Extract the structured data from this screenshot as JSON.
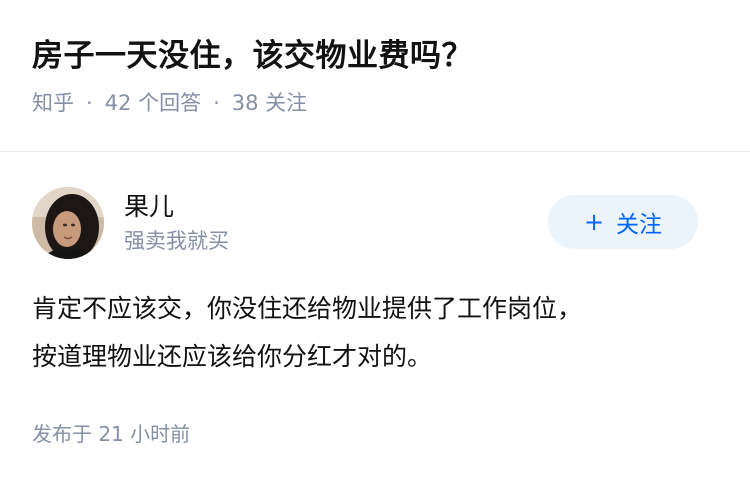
{
  "question": {
    "title": "房子一天没住，该交物业费吗？",
    "source": "知乎",
    "separator": "·",
    "answer_count": "42 个回答",
    "follower_count": "38 关注"
  },
  "answer": {
    "author_name": "果儿",
    "author_bio": "强卖我就买",
    "follow_label": "关注",
    "follow_icon": "plus-icon",
    "content_line1": "肯定不应该交，你没住还给物业提供了工作岗位，",
    "content_line2": "按道理物业还应该给你分红才对的。",
    "published_time": "发布于 21 小时前"
  },
  "colors": {
    "text_primary": "#121212",
    "text_secondary": "#8590a6",
    "accent": "#0066ff",
    "follow_bg": "#ebf3fb",
    "divider": "#ebebeb"
  }
}
